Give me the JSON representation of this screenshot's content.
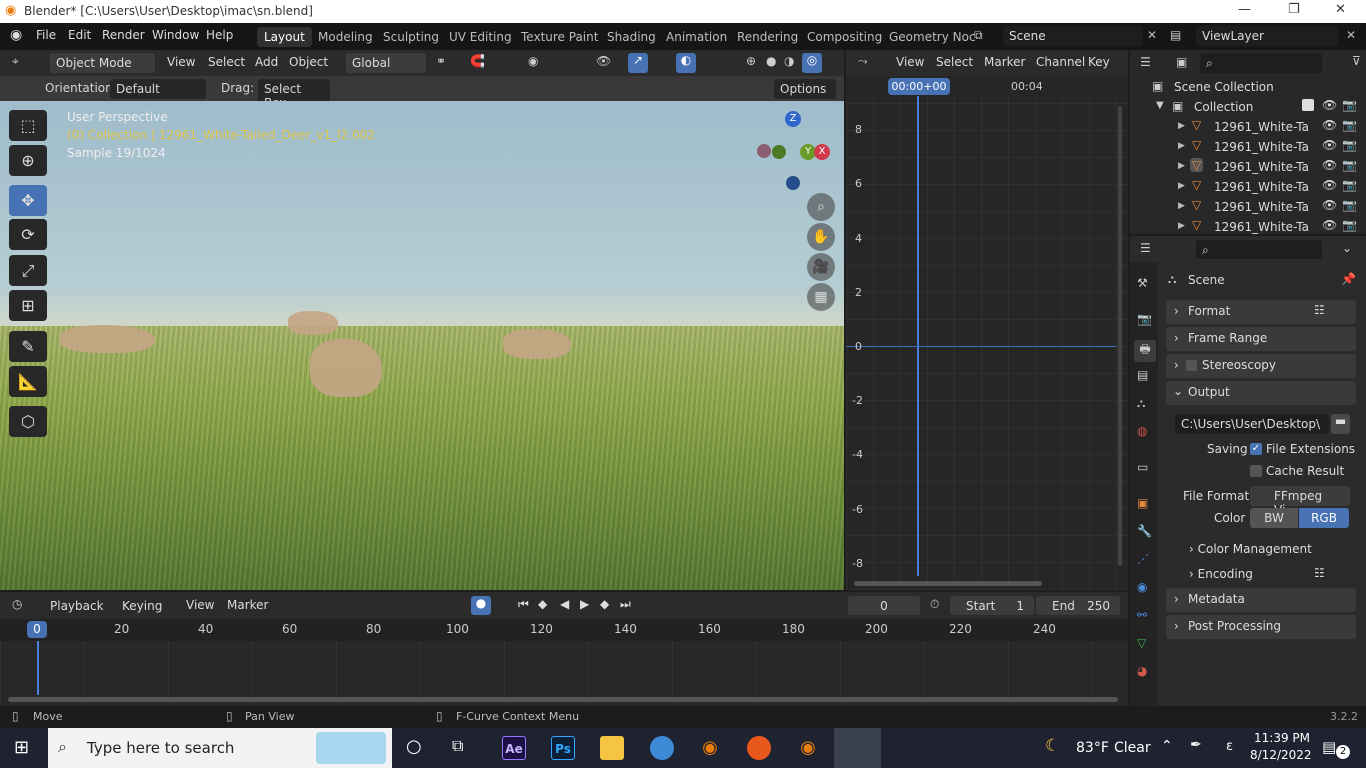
{
  "window": {
    "title": "Blender* [C:\\Users\\User\\Desktop\\imac\\sn.blend]",
    "minimize": "—",
    "maximize": "❐",
    "close": "✕"
  },
  "menu": {
    "file": "File",
    "edit": "Edit",
    "render": "Render",
    "window": "Window",
    "help": "Help"
  },
  "workspaces": [
    "Layout",
    "Modeling",
    "Sculpting",
    "UV Editing",
    "Texture Paint",
    "Shading",
    "Animation",
    "Rendering",
    "Compositing",
    "Geometry Noc"
  ],
  "scene": {
    "name": "Scene",
    "view_layer": "ViewLayer"
  },
  "viewport": {
    "mode": "Object Mode",
    "menus": [
      "View",
      "Select",
      "Add",
      "Object"
    ],
    "transform": "Global",
    "orientation_label": "Orientation:",
    "orientation_value": "Default",
    "drag_label": "Drag:",
    "drag_value": "Select Box",
    "options": "Options",
    "info_perspective": "User Perspective",
    "info_collection": "(0) Collection | 12961_White-Tailed_Deer_v1_l2.002",
    "info_sample": "Sample 19/1024",
    "gizmo": {
      "z": "Z",
      "y": "Y",
      "x": "X"
    }
  },
  "graph_editor": {
    "menus": [
      "View",
      "Select",
      "Marker",
      "Channel",
      "Key"
    ],
    "current_time": "00:00+00",
    "time_marker": "00:04",
    "y_ticks": [
      "8",
      "6",
      "4",
      "2",
      "0",
      "-2",
      "-4",
      "-6",
      "-8"
    ]
  },
  "outliner": {
    "root": "Scene Collection",
    "collection": "Collection",
    "items": [
      "12961_White-Ta",
      "12961_White-Ta",
      "12961_White-Ta",
      "12961_White-Ta",
      "12961_White-Ta",
      "12961_White-Ta"
    ]
  },
  "properties": {
    "context": "Scene",
    "panels": {
      "format": "Format",
      "frame_range": "Frame Range",
      "stereoscopy": "Stereoscopy",
      "output": "Output",
      "color_management": "Color Management",
      "encoding": "Encoding",
      "metadata": "Metadata",
      "post_processing": "Post Processing"
    },
    "output_path": "C:\\Users\\User\\Desktop\\",
    "saving_label": "Saving",
    "file_extensions": "File Extensions",
    "cache_result": "Cache Result",
    "file_format_label": "File Format",
    "file_format_value": "FFmpeg Vi...",
    "color_label": "Color",
    "color_bw": "BW",
    "color_rgb": "RGB"
  },
  "timeline": {
    "menus": {
      "playback": "Playback",
      "keying": "Keying",
      "view": "View",
      "marker": "Marker"
    },
    "current_frame": "0",
    "start_label": "Start",
    "start_value": "1",
    "end_label": "End",
    "end_value": "250",
    "ruler": [
      "0",
      "20",
      "40",
      "60",
      "80",
      "100",
      "120",
      "140",
      "160",
      "180",
      "200",
      "220",
      "240"
    ]
  },
  "statusbar": {
    "move": "Move",
    "pan": "Pan View",
    "context_menu": "F-Curve Context Menu",
    "version": "3.2.2"
  },
  "taskbar": {
    "search_placeholder": "Type here to search",
    "ae": "Ae",
    "ps": "Ps",
    "weather_temp": "83°F",
    "weather_desc": "Clear",
    "time": "11:39 PM",
    "date": "8/12/2022",
    "notifications": "2",
    "lang": "ε"
  },
  "colors": {
    "accent": "#4772b3",
    "playhead": "#4a7cd9",
    "orange": "#e48a3a"
  }
}
